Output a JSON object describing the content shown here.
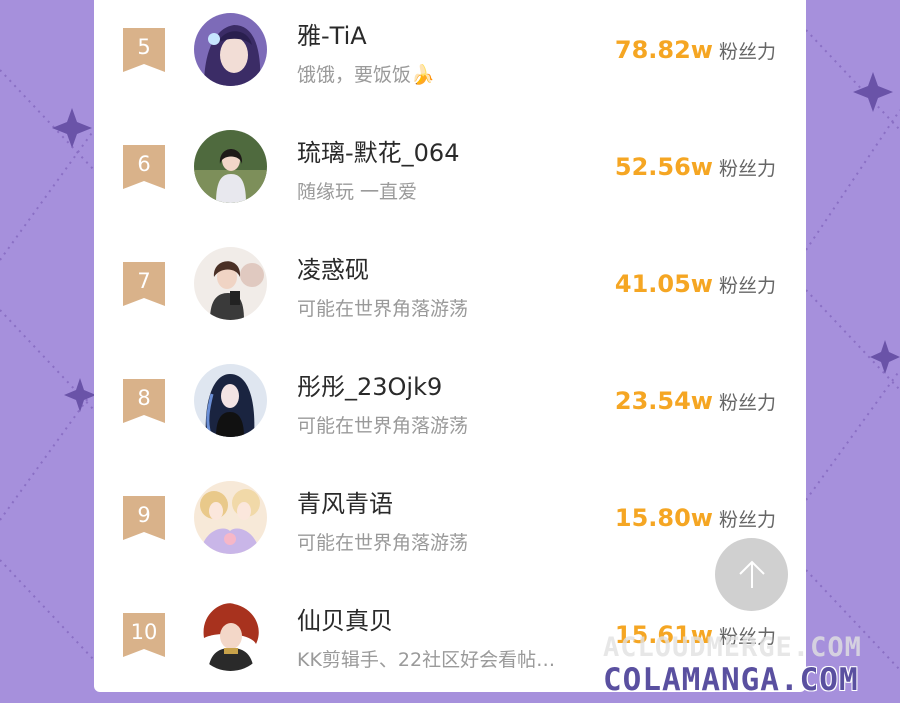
{
  "colors": {
    "background": "#a690dc",
    "rank_badge": "#d9b28a",
    "fans_number": "#f5a623"
  },
  "ranking": [
    {
      "rank": "5",
      "name": "雅-TiA",
      "bio": "饿饿，要饭饭🍌",
      "fans": "78.82w",
      "fans_label": "粉丝力",
      "avatar_icon": "avatar-anime-purple-hair"
    },
    {
      "rank": "6",
      "name": "琉璃-默花_064",
      "bio": "随缘玩 一直爱",
      "fans": "52.56w",
      "fans_label": "粉丝力",
      "avatar_icon": "avatar-girl-photo"
    },
    {
      "rank": "7",
      "name": "凌惑砚",
      "bio": "可能在世界角落游荡",
      "fans": "41.05w",
      "fans_label": "粉丝力",
      "avatar_icon": "avatar-boy-with-bear"
    },
    {
      "rank": "8",
      "name": "彤彤_23Ojk9",
      "bio": "可能在世界角落游荡",
      "fans": "23.54w",
      "fans_label": "粉丝力",
      "avatar_icon": "avatar-anime-girl-dark"
    },
    {
      "rank": "9",
      "name": "青风青语",
      "bio": "可能在世界角落游荡",
      "fans": "15.80w",
      "fans_label": "粉丝力",
      "avatar_icon": "avatar-anime-pastel"
    },
    {
      "rank": "10",
      "name": "仙贝真贝",
      "bio": "KK剪辑手、22社区好会看帖…",
      "fans": "15.61w",
      "fans_label": "粉丝力",
      "avatar_icon": "avatar-anime-red-hair"
    }
  ],
  "back_to_top_icon": "arrow-up-icon",
  "watermark": {
    "line1": "ACLOUDMERGE.COM",
    "line2": "COLAMANGA.COM"
  }
}
